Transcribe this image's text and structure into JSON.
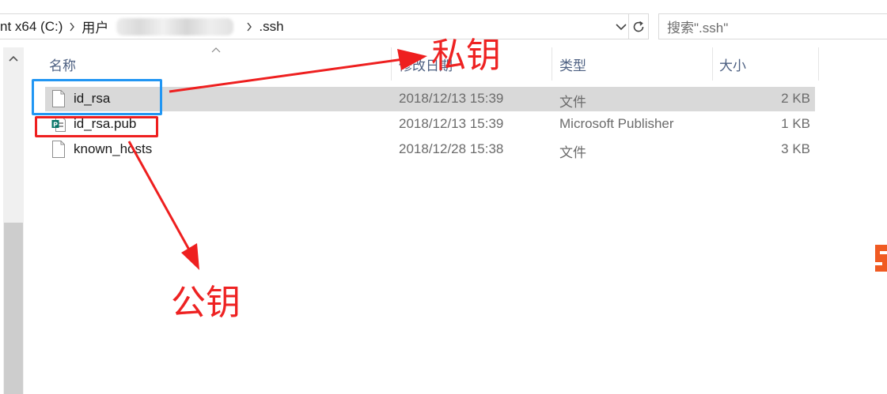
{
  "address_bar": {
    "drive_crumb": "nt x64 (C:)",
    "users_crumb": "用户",
    "folder_crumb": ".ssh"
  },
  "search": {
    "placeholder": "搜索\".ssh\""
  },
  "columns": {
    "name": "名称",
    "date": "修改日期",
    "type": "类型",
    "size": "大小"
  },
  "files": [
    {
      "name": "id_rsa",
      "date": "2018/12/13 15:39",
      "type": "文件",
      "size": "2 KB",
      "icon": "blank-file-icon",
      "selected": true
    },
    {
      "name": "id_rsa.pub",
      "date": "2018/12/13 15:39",
      "type": "Microsoft Publisher",
      "size": "1 KB",
      "icon": "publisher-file-icon",
      "selected": false
    },
    {
      "name": "known_hosts",
      "date": "2018/12/28 15:38",
      "type": "文件",
      "size": "3 KB",
      "icon": "blank-file-icon",
      "selected": false
    }
  ],
  "annotations": {
    "private_key_label": "私钥",
    "public_key_label": "公钥",
    "color_red": "#ee2222",
    "color_blue": "#2196f3"
  },
  "colors": {
    "selected_row": "#d9d9d9",
    "header_text": "#4d6082"
  }
}
